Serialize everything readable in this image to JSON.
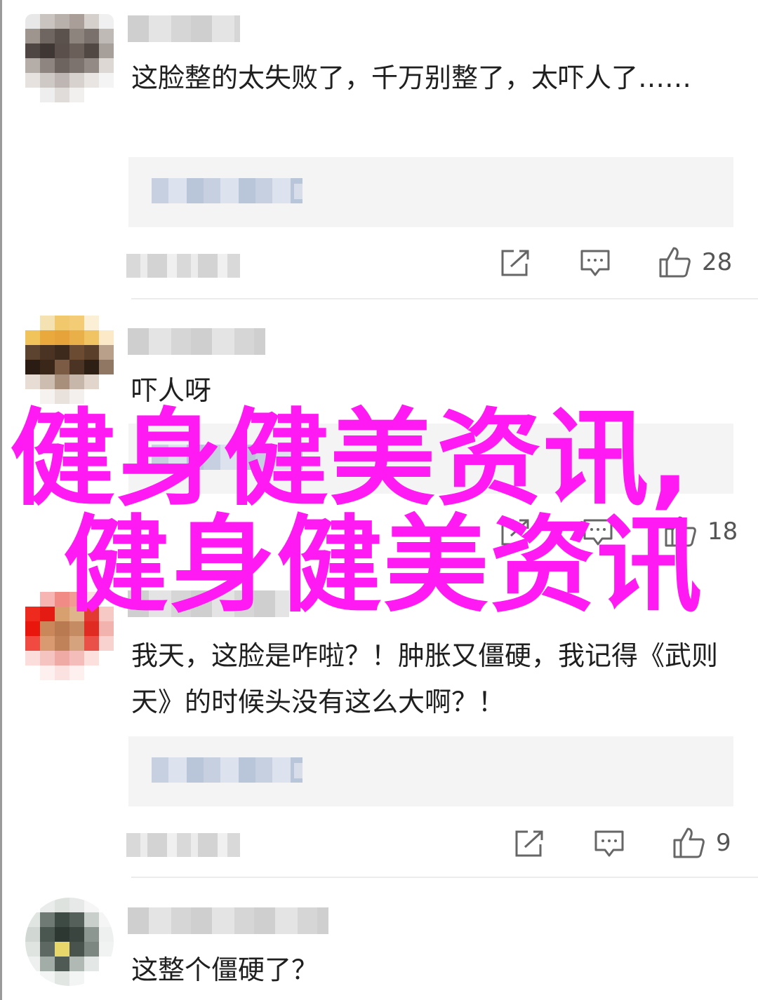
{
  "comments": [
    {
      "text": "这脸整的太失败了，千万别整了，太吓人了……",
      "likes": "28",
      "avatar_colors": [
        "#e8e8e8",
        "#c9c4c0",
        "#b8b0aa",
        "#a99f98",
        "#d5d0cc",
        "#f0f0f0",
        "#9e958f",
        "#6f6661",
        "#5c524d",
        "#8d847e",
        "#7a716c",
        "#c0bab6",
        "#4e4642",
        "#3f3734",
        "#5a4f4a",
        "#6b5f59",
        "#514844",
        "#a79f9a",
        "#b5ada8",
        "#8e8580",
        "#6d6460",
        "#7d736e",
        "#938a85",
        "#ddd8d4",
        "#e6e2df",
        "#cfc9c5",
        "#bdb6b2",
        "#d8d2ce",
        "#e9e5e2",
        "#f4f4f4",
        "#ffffff",
        "#eeeeee",
        "#e0dcd9",
        "#f2f0ee",
        "#ffffff",
        "#ffffff"
      ]
    },
    {
      "text": "吓人呀",
      "likes": "18",
      "avatar_colors": [
        "#ffffff",
        "#f4e2b3",
        "#f2c86d",
        "#f4cc75",
        "#fbefd5",
        "#ffffff",
        "#f0c35b",
        "#e9a93c",
        "#e5a33a",
        "#e9b04a",
        "#f0c363",
        "#fbe9c8",
        "#5c4330",
        "#4a3323",
        "#3d2a1d",
        "#6b4c33",
        "#5a3f2b",
        "#b8a08a",
        "#2a1c13",
        "#3a2719",
        "#7b5b43",
        "#4b3424",
        "#2e1f15",
        "#8f7763",
        "#e7ddd4",
        "#cdbdb0",
        "#a88f7b",
        "#c7b7aa",
        "#e2d6cc",
        "#ffffff",
        "#ffffff",
        "#f6f2ef",
        "#e9e2dc",
        "#f4f0ed",
        "#ffffff",
        "#ffffff"
      ]
    },
    {
      "text": "我天，这脸是咋啦？！肿胀又僵硬，我记得《武则天》的时候头没有这么大啊？！",
      "likes": "9",
      "avatar_colors": [
        "#ffffff",
        "#f6b5b2",
        "#f08b86",
        "#f29a94",
        "#fbe2e0",
        "#ffffff",
        "#ee2a1f",
        "#e41b12",
        "#d9a06f",
        "#e0b48a",
        "#e23a30",
        "#f6c9c5",
        "#e8160d",
        "#c9875a",
        "#b97a52",
        "#c58c63",
        "#df2b22",
        "#f2b3ae",
        "#f04a41",
        "#d99a72",
        "#c08259",
        "#d5a37e",
        "#ea5048",
        "#f8d2cf",
        "#fbdedc",
        "#f5c4c0",
        "#f0aaa5",
        "#f4bdb9",
        "#fbe0de",
        "#ffffff",
        "#ffffff",
        "#fdf0ef",
        "#fbe2e0",
        "#fdf0ef",
        "#ffffff",
        "#ffffff"
      ]
    },
    {
      "text": "这整个僵硬了？",
      "avatar_colors": [
        "#ffffff",
        "#e9ecea",
        "#dde2df",
        "#e6e9e7",
        "#f5f6f5",
        "#ffffff",
        "#e0e5e2",
        "#6f7a74",
        "#3e4a44",
        "#55605a",
        "#c9d0cc",
        "#f4f5f4",
        "#d1d8d4",
        "#4a5650",
        "#2d3832",
        "#3a453f",
        "#8c9792",
        "#eef0ef",
        "#dfe4e1",
        "#5d6863",
        "#e8d76a",
        "#48534d",
        "#7c8782",
        "#f1f3f2",
        "#eef0ef",
        "#a3ada8",
        "#4f5a54",
        "#b0b9b4",
        "#e3e7e5",
        "#ffffff",
        "#ffffff",
        "#f3f5f4",
        "#e1e6e3",
        "#f3f5f4",
        "#ffffff",
        "#ffffff"
      ]
    }
  ],
  "overlay_lines": [
    "健身健美资讯,",
    "健身健美资讯"
  ],
  "colors": {
    "overlay": "#ff19f2",
    "icon": "#666666"
  },
  "icons": [
    "share-icon",
    "comment-icon",
    "thumbs-up-icon"
  ]
}
